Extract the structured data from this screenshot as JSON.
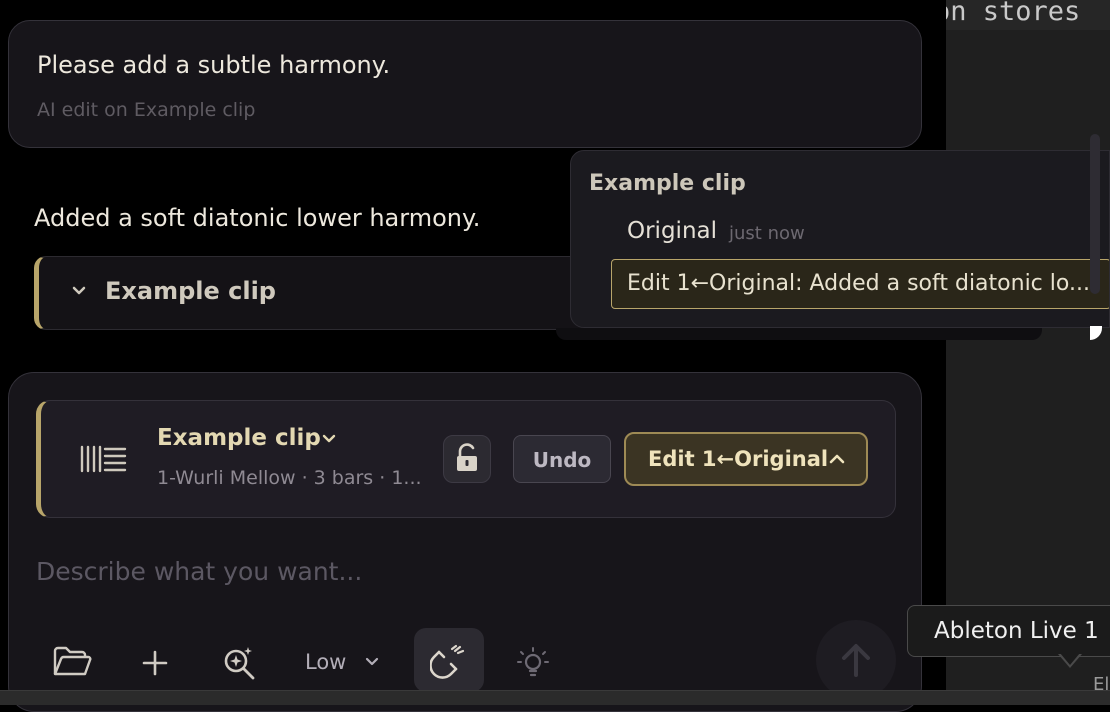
{
  "editor": {
    "code_fragment": "on stores"
  },
  "conversation": {
    "user_message": "Please add a subtle harmony.",
    "user_meta": "AI edit on Example clip",
    "assistant_reply": "Added a soft diatonic lower harmony.",
    "clip_card_title": "Example clip"
  },
  "version_popover": {
    "heading": "Example clip",
    "original_label": "Original",
    "original_time": "just now",
    "selected_item": "Edit 1←Original: Added a soft diatonic lo..."
  },
  "composer": {
    "clip_name": "Example clip",
    "clip_details": "1-Wurli Mellow · 3 bars · 1...",
    "undo_label": "Undo",
    "version_label": "Edit 1←Original",
    "placeholder": "Describe what you want...",
    "effort_label": "Low"
  },
  "tooltip": {
    "text": "Ableton Live 1"
  },
  "statusbar": {
    "fragment": "El"
  },
  "colors": {
    "accent_gold": "#b8a56a",
    "background": "#000000",
    "panel": "#17151a"
  },
  "icons": [
    "folder-icon",
    "plus-icon",
    "zoom-icon",
    "chevron-down-icon",
    "magnet-icon",
    "lightbulb-icon",
    "arrow-up-icon",
    "lock-open-icon",
    "clip-icon"
  ]
}
